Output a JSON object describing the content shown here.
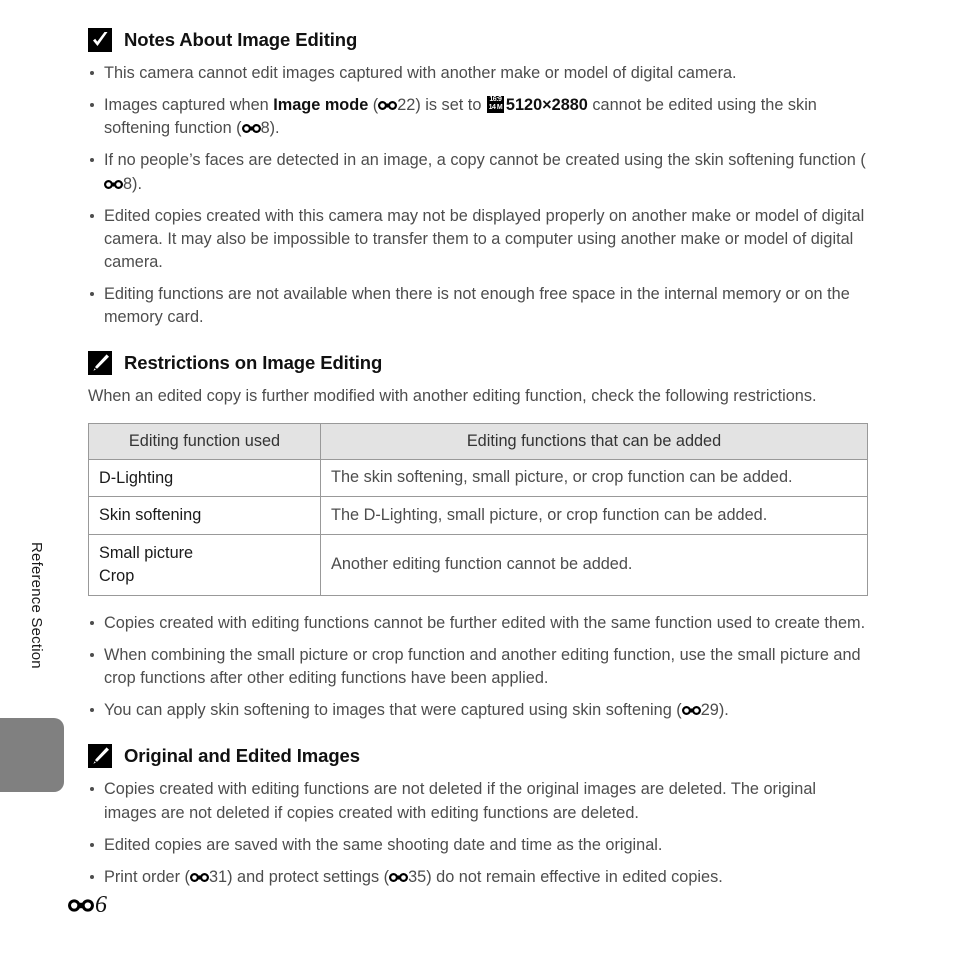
{
  "sidebar": {
    "label": "Reference Section",
    "tab_color": "#808080"
  },
  "page_number": {
    "prefix_icon": "e-reference-icon",
    "value": "6"
  },
  "sections": [
    {
      "icon": "checkmark-icon",
      "title": "Notes About Image Editing",
      "bullets": [
        "This camera cannot edit images captured with another make or model of digital camera.",
        "Images captured when Image mode (E22) is set to 16:9 14M 5120×2880 cannot be edited using the skin softening function (E8).",
        "If no people’s faces are detected in an image, a copy cannot be created using the skin softening function (E8).",
        "Edited copies created with this camera may not be displayed properly on another make or model of digital camera. It may also be impossible to transfer them to a computer using another make or model of digital camera.",
        "Editing functions are not available when there is not enough free space in the internal memory or on the memory card."
      ]
    },
    {
      "icon": "pencil-icon",
      "title": "Restrictions on Image Editing",
      "intro": "When an edited copy is further modified with another editing function, check the following restrictions.",
      "bullets": [
        "Copies created with editing functions cannot be further edited with the same function used to create them.",
        "When combining the small picture or crop function and another editing function, use the small picture and crop functions after other editing functions have been applied.",
        "You can apply skin softening to images that were captured using skin softening (E29)."
      ]
    },
    {
      "icon": "pencil-icon",
      "title": "Original and Edited Images",
      "bullets": [
        "Copies created with editing functions are not deleted if the original images are deleted. The original images are not deleted if copies created with editing functions are deleted.",
        "Edited copies are saved with the same shooting date and time as the original.",
        "Print order (E31) and protect settings (E35) do not remain effective in edited copies."
      ]
    }
  ],
  "fragments": {
    "b2_pre": "Images captured when ",
    "b2_bold": "Image mode",
    "b2_open": " (",
    "b2_ref1": "22) is set to ",
    "b2_res": "5120×2880",
    "b2_post": " cannot be edited using the skin softening function (",
    "b2_ref2": "8).",
    "b3_pre": "If no people’s faces are detected in an image, a copy cannot be created using the skin softening function (",
    "b3_ref": "8).",
    "s2b3_pre": "You can apply skin softening to images that were captured using skin softening (",
    "s2b3_ref": "29).",
    "s3b3_pre": "Print order (",
    "s3b3_mid": "31) and protect settings (",
    "s3b3_end": "35) do not remain effective in edited copies."
  },
  "image_mode_icon": {
    "top": "16:9",
    "bottom": "14 M"
  },
  "table": {
    "headers": [
      "Editing function used",
      "Editing functions that can be added"
    ],
    "rows": [
      {
        "function": "D-Lighting",
        "added": "The skin softening, small picture, or crop function can be added."
      },
      {
        "function": "Skin softening",
        "added": "The D-Lighting, small picture, or crop function can be added."
      },
      {
        "function_line1": "Small picture",
        "function_line2": "Crop",
        "added": "Another editing function cannot be added."
      }
    ]
  },
  "colors": {
    "header_fill": "#e3e3e3",
    "border": "#999999",
    "body_text": "#4d4d4d",
    "emphasis_text": "#111111",
    "tab_gray": "#808080"
  }
}
